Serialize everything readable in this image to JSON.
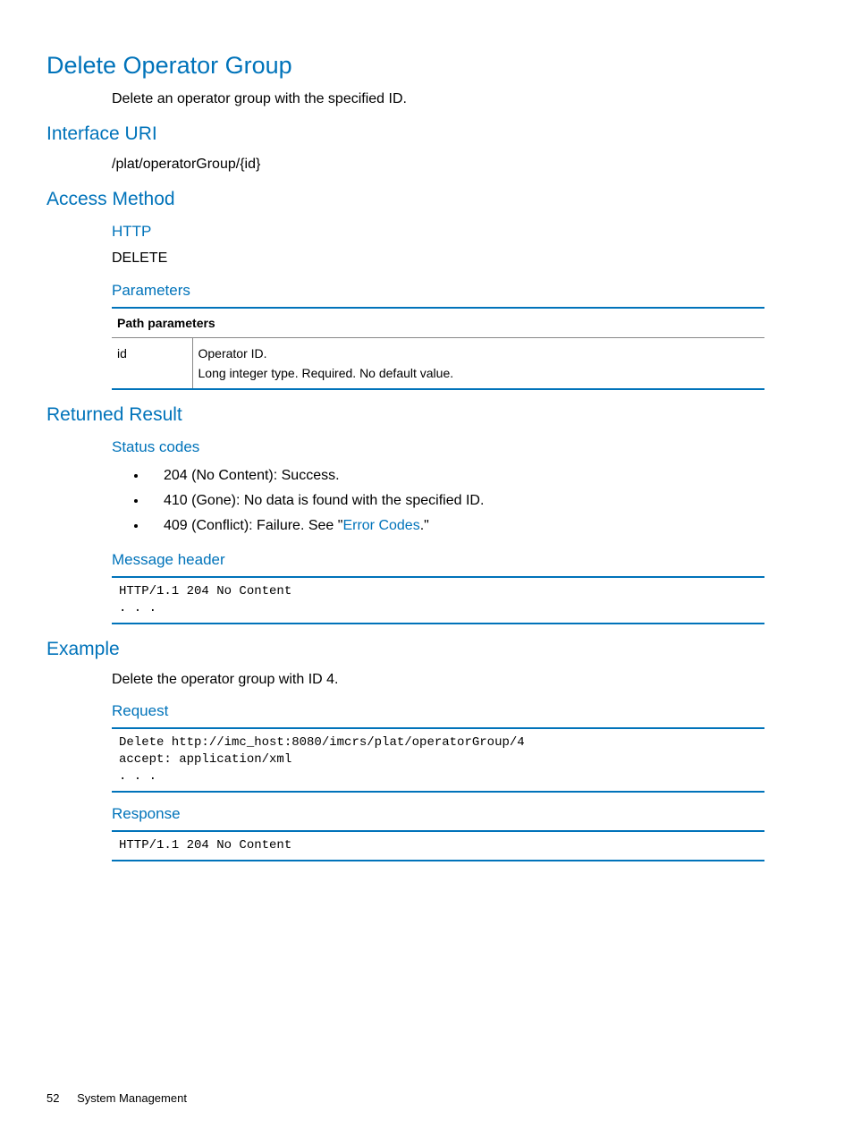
{
  "title": "Delete Operator Group",
  "intro": "Delete an operator group with the specified ID.",
  "sections": {
    "interface_uri": {
      "heading": "Interface URI",
      "value": "/plat/operatorGroup/{id}"
    },
    "access_method": {
      "heading": "Access Method",
      "http_heading": "HTTP",
      "http_value": "DELETE",
      "parameters_heading": "Parameters",
      "table": {
        "header": "Path parameters",
        "row_key": "id",
        "row_val_line1": "Operator ID.",
        "row_val_line2": "Long integer type. Required. No default value."
      }
    },
    "returned_result": {
      "heading": "Returned Result",
      "status_codes_heading": "Status codes",
      "codes": {
        "c204": "204 (No Content): Success.",
        "c410": "410 (Gone): No data is found with the specified ID.",
        "c409_prefix": "409 (Conflict): Failure. See \"",
        "c409_link": "Error Codes",
        "c409_suffix": ".\""
      },
      "message_header_heading": "Message header",
      "message_header_code": "HTTP/1.1 204 No Content\n. . ."
    },
    "example": {
      "heading": "Example",
      "intro": "Delete the operator group with ID 4.",
      "request_heading": "Request",
      "request_code": "Delete http://imc_host:8080/imcrs/plat/operatorGroup/4\naccept: application/xml\n. . .",
      "response_heading": "Response",
      "response_code": "HTTP/1.1 204 No Content"
    }
  },
  "footer": {
    "page": "52",
    "section": "System Management"
  }
}
